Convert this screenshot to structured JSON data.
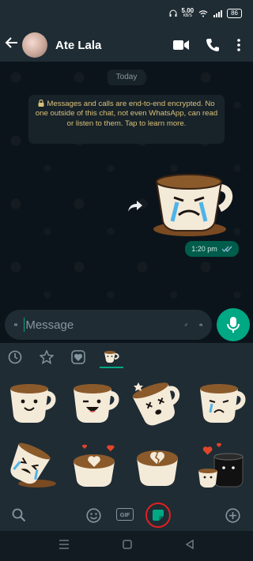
{
  "status_bar": {
    "net_speed": "5.00",
    "net_unit": "KB/S",
    "battery": "86"
  },
  "header": {
    "contact_name": "Ate Lala",
    "back_icon": "arrow-left-icon",
    "video_icon": "video-call-icon",
    "phone_icon": "phone-icon",
    "menu_icon": "more-vertical-icon"
  },
  "chat": {
    "date_label": "Today",
    "encryption_notice": "Messages and calls are end-to-end encrypted. No one outside of this chat, not even WhatsApp, can read or listen to them. Tap to learn more.",
    "messages": [
      {
        "type": "sticker",
        "sticker": "crying-coffee-cup",
        "time": "1:20 pm",
        "status": "read"
      }
    ]
  },
  "composer": {
    "placeholder": "Message",
    "value": ""
  },
  "sticker_panel": {
    "tabs": [
      "recent-icon",
      "star-icon",
      "heart-icon",
      "coffee-pack-icon"
    ],
    "active_tab": 3,
    "stickers": [
      "smiling-cup",
      "winking-cup",
      "dizzy-cup",
      "sad-cup",
      "crying-spill-cup",
      "heart-latte",
      "broken-heart-latte",
      "cups-with-hearts"
    ]
  },
  "keyboard_bar": [
    "search-icon",
    "emoji-icon",
    "gif-icon",
    "sticker-icon",
    "add-icon"
  ],
  "keyboard_gif_label": "GIF",
  "colors": {
    "accent": "#00a884",
    "background": "#0b141a",
    "panel": "#1f2c34",
    "outgoing_bubble": "#005c4b",
    "notice_text": "#d9c27a",
    "highlight_ring": "#e02020"
  }
}
